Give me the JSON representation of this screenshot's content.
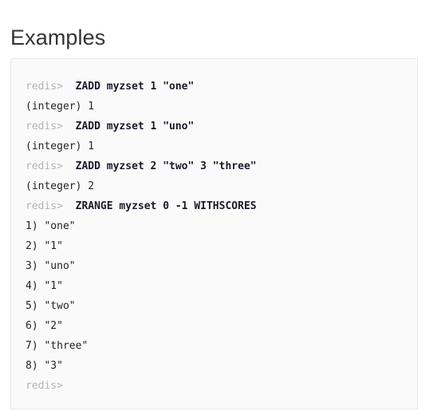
{
  "page": {
    "title": "Examples",
    "background": "#ffffff"
  },
  "code_block": {
    "background": "#fafafa",
    "border_color": "#e9e9e9",
    "prompt_color": "#b3b3b3",
    "command_color": "#1b1b2b",
    "reply_color": "#242424",
    "prompt": "redis>",
    "lines": [
      {
        "type": "command",
        "prompt": "redis>",
        "text": "ZADD myzset 1 \"one\""
      },
      {
        "type": "reply",
        "prompt": "",
        "text": "(integer) 1"
      },
      {
        "type": "command",
        "prompt": "redis>",
        "text": "ZADD myzset 1 \"uno\""
      },
      {
        "type": "reply",
        "prompt": "",
        "text": "(integer) 1"
      },
      {
        "type": "command",
        "prompt": "redis>",
        "text": "ZADD myzset 2 \"two\" 3 \"three\""
      },
      {
        "type": "reply",
        "prompt": "",
        "text": "(integer) 2"
      },
      {
        "type": "command",
        "prompt": "redis>",
        "text": "ZRANGE myzset 0 -1 WITHSCORES"
      },
      {
        "type": "reply",
        "prompt": "",
        "text": "1) \"one\""
      },
      {
        "type": "reply",
        "prompt": "",
        "text": "2) \"1\""
      },
      {
        "type": "reply",
        "prompt": "",
        "text": "3) \"uno\""
      },
      {
        "type": "reply",
        "prompt": "",
        "text": "4) \"1\""
      },
      {
        "type": "reply",
        "prompt": "",
        "text": "5) \"two\""
      },
      {
        "type": "reply",
        "prompt": "",
        "text": "6) \"2\""
      },
      {
        "type": "reply",
        "prompt": "",
        "text": "7) \"three\""
      },
      {
        "type": "reply",
        "prompt": "",
        "text": "8) \"3\""
      },
      {
        "type": "prompt_only",
        "prompt": "redis>",
        "text": ""
      }
    ]
  }
}
